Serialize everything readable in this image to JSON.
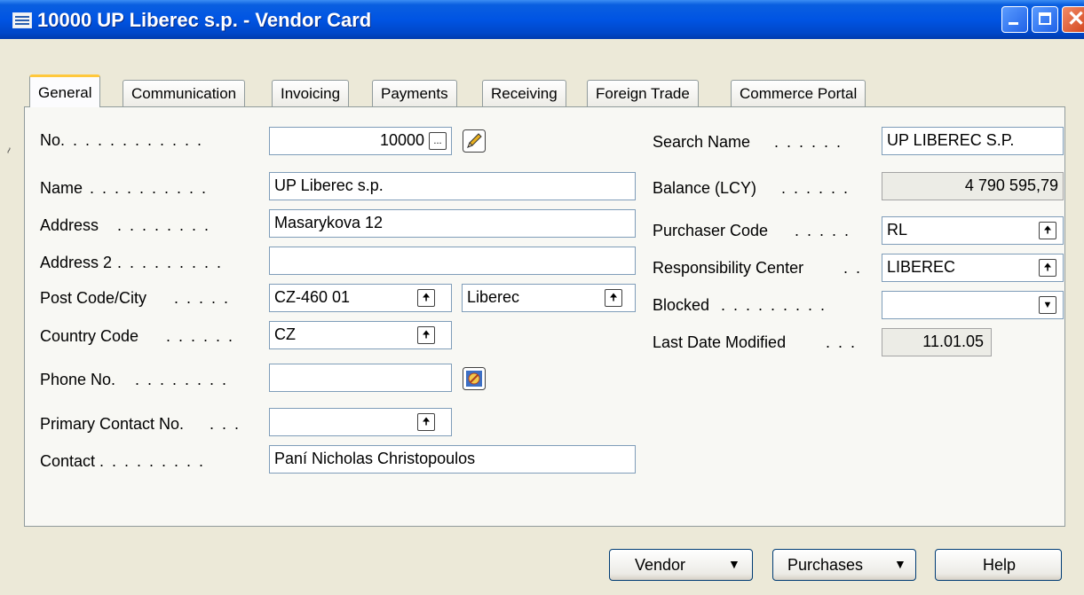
{
  "window": {
    "title": "10000 UP Liberec s.p. - Vendor Card"
  },
  "tabs": [
    "General",
    "Communication",
    "Invoicing",
    "Payments",
    "Receiving",
    "Foreign Trade",
    "Commerce Portal"
  ],
  "left_fields": {
    "no": {
      "label": "No.",
      "value": "10000"
    },
    "name": {
      "label": "Name",
      "value": "UP Liberec s.p."
    },
    "address": {
      "label": "Address",
      "value": "Masarykova 12"
    },
    "address2": {
      "label": "Address 2",
      "value": ""
    },
    "post_code_city": {
      "label": "Post Code/City",
      "post_code": "CZ-460 01",
      "city": "Liberec"
    },
    "country_code": {
      "label": "Country Code",
      "value": "CZ"
    },
    "phone_no": {
      "label": "Phone No.",
      "value": ""
    },
    "primary_contact_no": {
      "label": "Primary Contact No.",
      "value": ""
    },
    "contact": {
      "label": "Contact",
      "value": "Paní Nicholas Christopoulos"
    }
  },
  "right_fields": {
    "search_name": {
      "label": "Search Name",
      "value": "UP LIBEREC S.P."
    },
    "balance_lcy": {
      "label": "Balance (LCY)",
      "value": "4 790 595,79"
    },
    "purchaser_code": {
      "label": "Purchaser Code",
      "value": "RL"
    },
    "responsibility_center": {
      "label": "Responsibility Center",
      "value": "LIBEREC"
    },
    "blocked": {
      "label": "Blocked",
      "value": ""
    },
    "last_date_modified": {
      "label": "Last Date Modified",
      "value": "11.01.05"
    }
  },
  "buttons": {
    "vendor": "Vendor",
    "purchases": "Purchases",
    "help": "Help"
  },
  "icons": {
    "lookup_ellipsis": "...",
    "lookup_arrow": "🠉",
    "dropdown_arrow": "▼"
  }
}
